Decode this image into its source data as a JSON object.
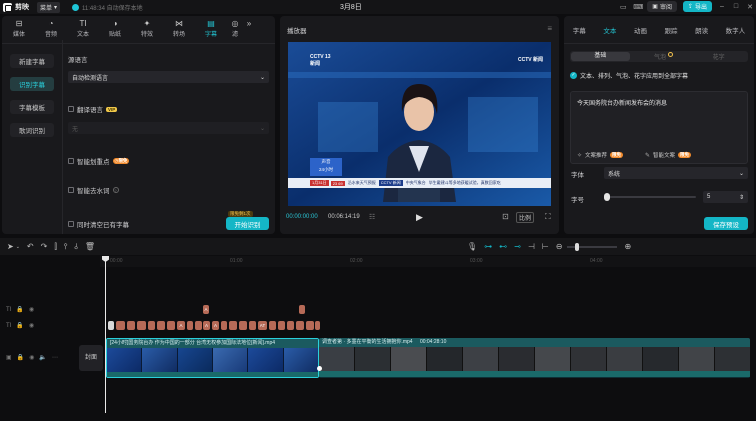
{
  "app": {
    "name": "剪映",
    "menu_label": "菜单",
    "autosave": "11:48:34 自动保存本地",
    "project_title": "3月8日"
  },
  "topright": {
    "review": "审阅",
    "export": "导出"
  },
  "left_tabs": [
    {
      "label": "媒体",
      "icon": "media-icon"
    },
    {
      "label": "音频",
      "icon": "audio-icon"
    },
    {
      "label": "文本",
      "icon": "text-icon"
    },
    {
      "label": "贴纸",
      "icon": "sticker-icon"
    },
    {
      "label": "特效",
      "icon": "effects-icon"
    },
    {
      "label": "转场",
      "icon": "transition-icon"
    },
    {
      "label": "字幕",
      "icon": "subtitle-icon"
    },
    {
      "label": "滤",
      "icon": "filter-icon"
    }
  ],
  "left_side": {
    "new_subtitle": "新建字幕",
    "recognize_subtitle": "识别字幕",
    "subtitle_template": "字幕模板",
    "lyrics": "歌词识别"
  },
  "recog": {
    "source_lang_label": "源语言",
    "source_lang_value": "自动检测语言",
    "translate_label": "翻译语言",
    "vip": "VIP",
    "target_lang_value": "无",
    "smart_punct": "智能划重点",
    "limited_free": "限免",
    "smart_watermark": "智能去水词",
    "clear_existing": "同时清空已有字幕",
    "start_btn": "开始识别",
    "start_badge": "限免剩1次"
  },
  "player": {
    "title": "播放器",
    "time_current": "00:00:00:00",
    "time_total": "00:06:14:19",
    "ratio": "比例"
  },
  "video": {
    "channel_bug": "CCTV 13",
    "channel_sub": "新闻",
    "bottom_box": "声音",
    "bottom_date": "24小时",
    "ticker_date": "1月31日",
    "ticker_temp": "23 69",
    "ticker_text1": "沿水来天气预报",
    "ticker_bug": "CCTV 新闻",
    "ticker_text2": "中央气象台",
    "ticker_text3": "毕生戴建斗等多地获暖试验，真数回家吃",
    "corner_bug": "CCTV 新闻"
  },
  "right_tabs": [
    "字幕",
    "文本",
    "动画",
    "跟踪",
    "朗读",
    "数字人"
  ],
  "right_seg": [
    "基础",
    "气泡",
    "花字"
  ],
  "right": {
    "apply_all": "文本、排列、气泡、花字应用到全部字幕",
    "text_content": "今天国务院台办新闻发布会的消息",
    "recommend": "文案推荐",
    "limited_free": "限免",
    "smart_copy": "智能文案",
    "font_label": "字体",
    "font_value": "系统",
    "size_label": "字号",
    "size_value": "5",
    "save_preset": "保存预设"
  },
  "timeline": {
    "ruler": [
      "00:00",
      "01:00",
      "02:00",
      "03:00",
      "04:00"
    ],
    "clip1_label": "[24小时]国务院台办 作为中国的一部分 台湾无权参加国际法地位[新闻].mp4",
    "clip1_duration": "00",
    "clip2_label": "调查者第 · 多墨在平衡的生活拥抱你.mp4",
    "clip2_duration": "00:04:28:10",
    "cover": "封面"
  },
  "chip_labels": {
    "a": "A",
    "at": "AT"
  },
  "colors": {
    "accent": "#14b6c6",
    "bg": "#0d0d0f",
    "panel": "#19191c",
    "clip_head": "#1b5a5f",
    "subtitle_chip": "#b66a57"
  }
}
